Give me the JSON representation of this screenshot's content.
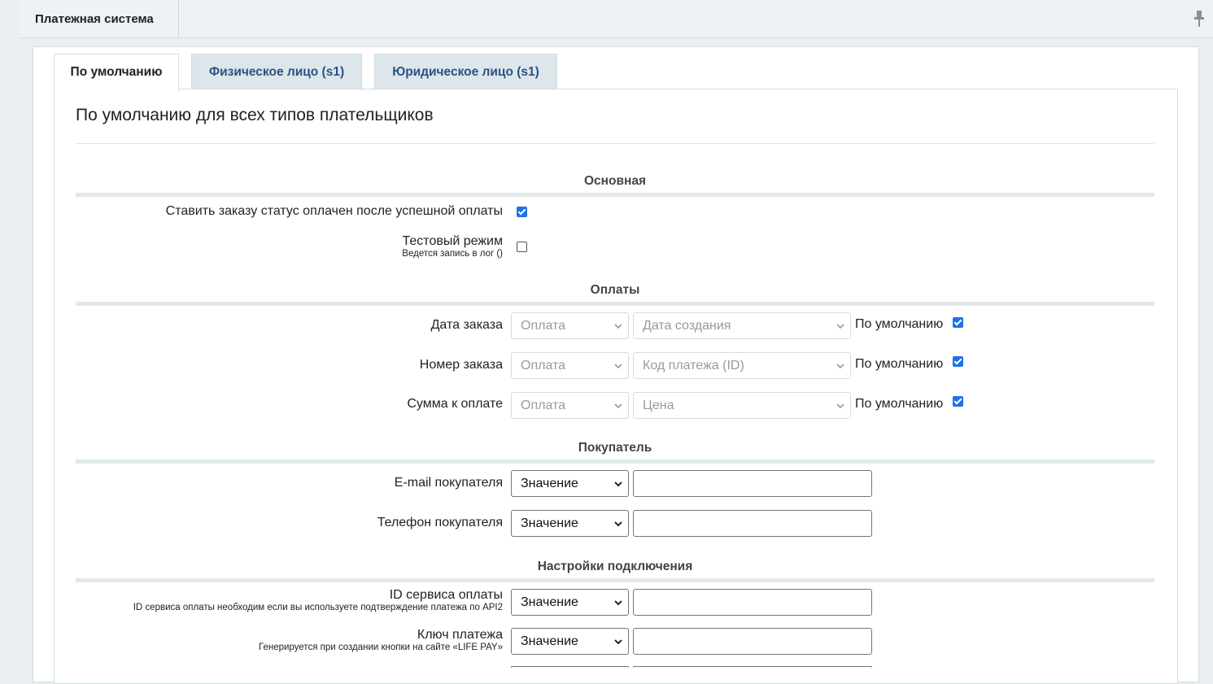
{
  "header": {
    "title": "Платежная система"
  },
  "tabs": [
    {
      "label": "По умолчанию",
      "active": true
    },
    {
      "label": "Физическое лицо (s1)",
      "active": false
    },
    {
      "label": "Юридическое лицо (s1)",
      "active": false
    }
  ],
  "page_title": "По умолчанию для всех типов плательщиков",
  "sections": {
    "main": {
      "title": "Основная",
      "paid_status": {
        "label": "Ставить заказу статус оплачен после успешной оплаты",
        "checked": true
      },
      "test_mode": {
        "label": "Тестовый режим",
        "hint": "Ведется запись в лог ()",
        "checked": false
      }
    },
    "payments": {
      "title": "Оплаты",
      "default_label": "По умолчанию",
      "rows": [
        {
          "label": "Дата заказа",
          "type_value": "Оплата",
          "field_value": "Дата создания",
          "default_checked": true
        },
        {
          "label": "Номер заказа",
          "type_value": "Оплата",
          "field_value": "Код платежа (ID)",
          "default_checked": true
        },
        {
          "label": "Сумма к оплате",
          "type_value": "Оплата",
          "field_value": "Цена",
          "default_checked": true
        }
      ]
    },
    "buyer": {
      "title": "Покупатель",
      "rows": [
        {
          "label": "E-mail покупателя",
          "type_value": "Значение",
          "input_value": ""
        },
        {
          "label": "Телефон покупателя",
          "type_value": "Значение",
          "input_value": ""
        }
      ]
    },
    "connection": {
      "title": "Настройки подключения",
      "rows": [
        {
          "label": "ID сервиса оплаты",
          "hint": "ID сервиса оплаты необходим если вы используете подтверждение платежа по API2",
          "type_value": "Значение",
          "input_value": ""
        },
        {
          "label": "Ключ платежа",
          "hint": "Генерируется при создании кнопки на сайте «LIFE PAY»",
          "type_value": "Значение",
          "input_value": ""
        }
      ]
    }
  },
  "colors": {
    "checkbox": "#1a73e8",
    "tab_link": "#2a5284",
    "section_rule": "#e0e8eb"
  }
}
